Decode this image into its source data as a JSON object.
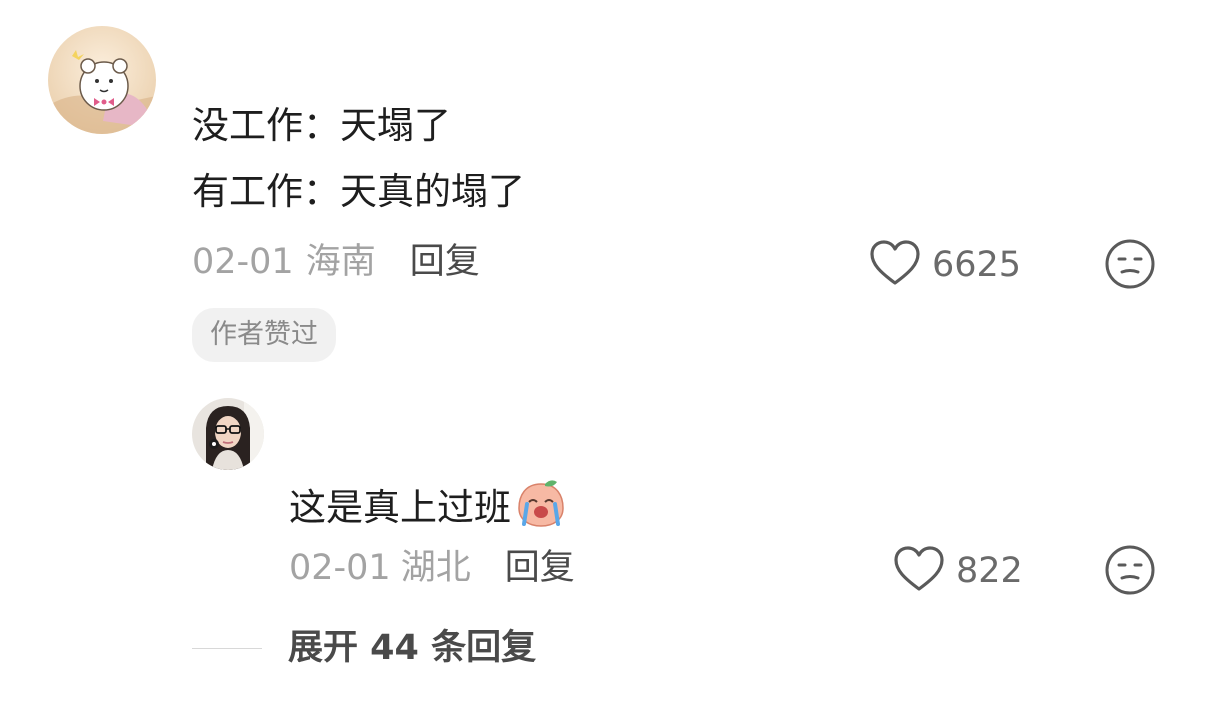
{
  "comment": {
    "lines": [
      "没工作：天塌了",
      "有工作：天真的塌了"
    ],
    "date": "02-01",
    "location": "海南",
    "reply_label": "回复",
    "like_count": "6625",
    "badge": "作者赞过"
  },
  "reply": {
    "text": "这是真上过班",
    "emoji": "crying-peach-emoji",
    "date": "02-01",
    "location": "湖北",
    "reply_label": "回复",
    "like_count": "822"
  },
  "expand_label": "展开 44 条回复",
  "icons": {
    "like": "heart-outline-icon",
    "dislike": "meh-face-icon"
  },
  "colors": {
    "text_primary": "#1e1e1e",
    "text_meta": "#a3a3a3",
    "text_action": "#4a4a4a",
    "badge_bg": "#f1f1f1"
  }
}
